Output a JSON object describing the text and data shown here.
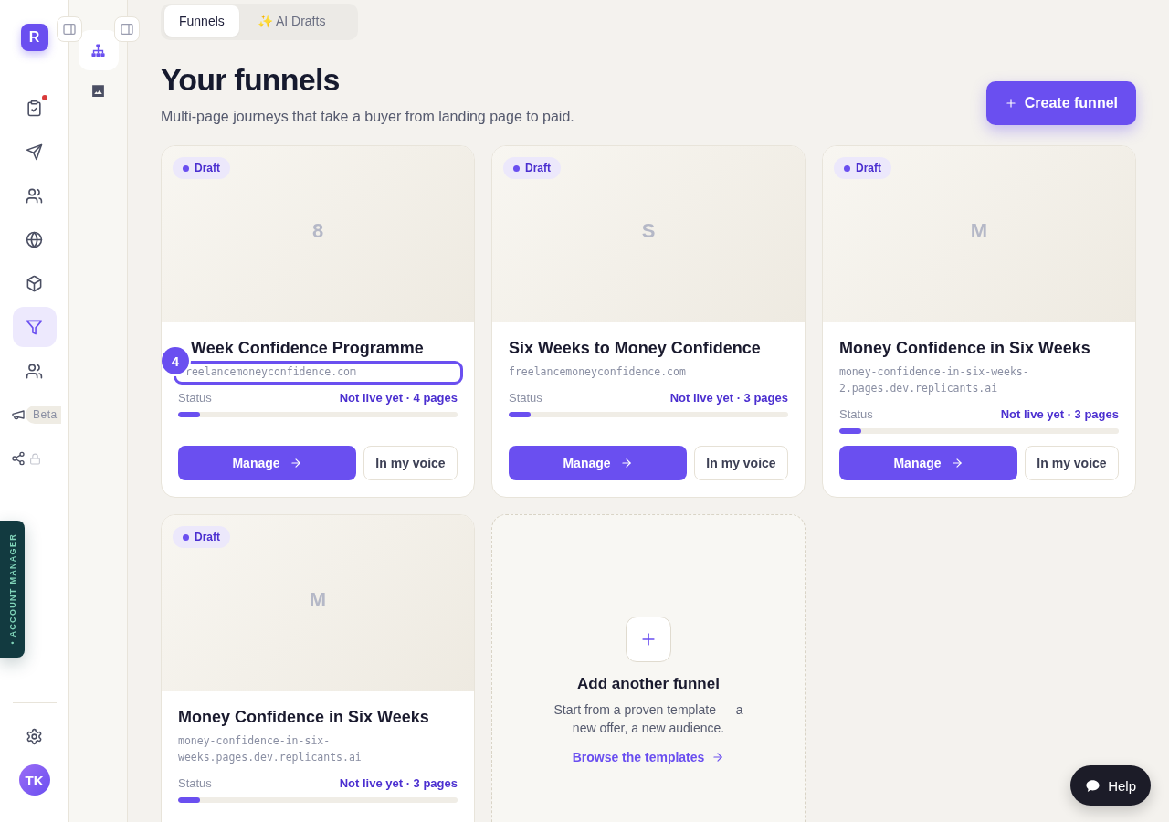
{
  "brand": {
    "logo": "R"
  },
  "nav": [
    {
      "selected": false,
      "notification": true
    },
    {
      "selected": false
    },
    {
      "selected": false
    },
    {
      "selected": false
    },
    {
      "selected": false
    },
    {
      "selected": true
    },
    {
      "selected": false
    },
    {
      "selected": false,
      "badge": "Beta"
    },
    {
      "selected": false,
      "locked": true
    }
  ],
  "account_manager_tab": {
    "label": "• ACCOUNT MANAGER"
  },
  "user": {
    "initials": "TK"
  },
  "sub_nav": [
    {
      "selected": true
    },
    {
      "selected": false
    }
  ],
  "tabs": [
    {
      "label": "Funnels",
      "selected": true
    },
    {
      "label": "✨ AI Drafts",
      "selected": false
    }
  ],
  "header": {
    "title": "Your funnels",
    "subtitle": "Multi-page journeys that take a buyer from landing page to paid.",
    "create_button": "Create funnel"
  },
  "funnels": [
    {
      "badge": "Draft",
      "initial": "8",
      "title": "Week Confidence Programme",
      "domain": "reelancemoneyconfidence.com",
      "tour_step": "4",
      "status_label": "Status",
      "status": "Not live yet · 4 pages",
      "level": 0.08,
      "actions": [
        "Manage",
        "In my voice"
      ]
    },
    {
      "badge": "Draft",
      "initial": "S",
      "title": "Six Weeks to Money Confidence",
      "domain": "freelancemoneyconfidence.com",
      "status_label": "Status",
      "status": "Not live yet · 3 pages",
      "level": 0.08,
      "actions": [
        "Manage",
        "In my voice"
      ]
    },
    {
      "badge": "Draft",
      "initial": "M",
      "title": "Money Confidence in Six Weeks",
      "domain": "money-confidence-in-six-weeks-2.pages.dev.replicants.ai",
      "status_label": "Status",
      "status": "Not live yet · 3 pages",
      "level": 0.08,
      "actions": [
        "Manage",
        "In my voice"
      ]
    },
    {
      "badge": "Draft",
      "initial": "M",
      "title": "Money Confidence in Six Weeks",
      "domain": "money-confidence-in-six-weeks.pages.dev.replicants.ai",
      "status_label": "Status",
      "status": "Not live yet · 3 pages",
      "level": 0.08
    }
  ],
  "add_card": {
    "title": "Add another funnel",
    "description": "Start from a proven template — a new offer, a new audience.",
    "link": "Browse the templates"
  },
  "help_button": {
    "label": "Help"
  }
}
